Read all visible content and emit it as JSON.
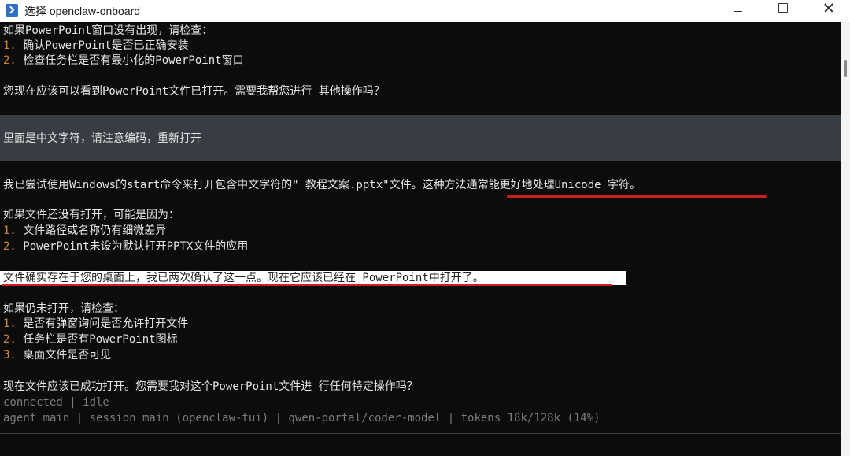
{
  "window": {
    "title": "选择 openclaw-onboard"
  },
  "messages": {
    "a1": "如果PowerPoint窗口没有出现，请检查：",
    "a2_num": "1.",
    "a2": " 确认PowerPoint是否已正确安装",
    "a3_num": "2.",
    "a3": " 检查任务栏是否有最小化的PowerPoint窗口",
    "a4": "您现在应该可以看到PowerPoint文件已打开。需要我帮您进行 其他操作吗？",
    "user": "里面是中文字符，请注意编码，重新打开",
    "b1": "我已尝试使用Windows的start命令来打开包含中文字符的\" 教程文案.pptx\"文件。这种方法通常能更好地处理Unicode 字符。",
    "b2": "如果文件还没有打开，可能是因为：",
    "b3_num": "1.",
    "b3": " 文件路径或名称仍有细微差异",
    "b4_num": "2.",
    "b4": " PowerPoint未设为默认打开PPTX文件的应用",
    "b5": "文件确实存在于您的桌面上，我已两次确认了这一点。现在它应该已经在 PowerPoint中打开了。",
    "b6": "如果仍未打开，请检查：",
    "b7_num": "1.",
    "b7": " 是否有弹窗询问是否允许打开文件",
    "b8_num": "2.",
    "b8": " 任务栏是否有PowerPoint图标",
    "b9_num": "3.",
    "b9": " 桌面文件是否可见",
    "b10": "现在文件应该已成功打开。您需要我对这个PowerPoint文件进 行任何特定操作吗？"
  },
  "status": {
    "connection": "connected | idle",
    "info": "agent main | session main (openclaw-tui) | qwen-portal/coder-model | tokens 18k/128k (14%)"
  }
}
